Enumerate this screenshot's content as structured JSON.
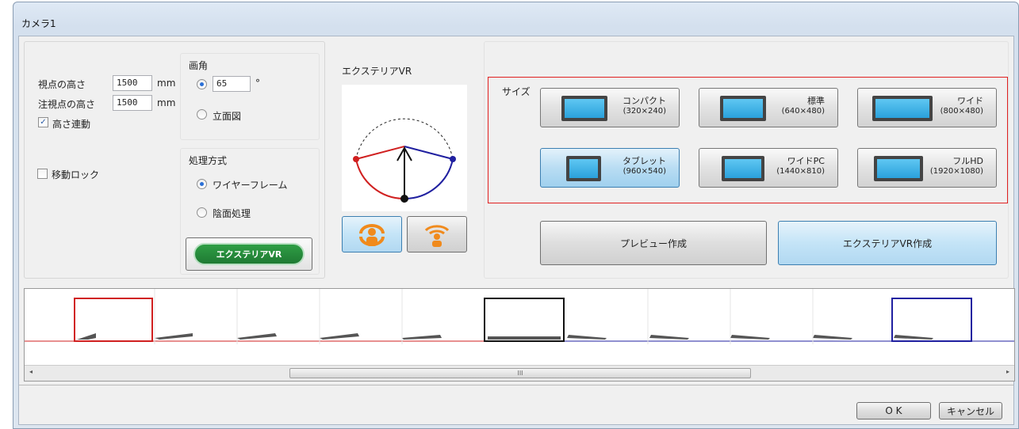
{
  "window": {
    "title": "カメラ1"
  },
  "view": {
    "eye_height_label": "視点の高さ",
    "eye_height_value": "1500",
    "eye_height_unit": "mm",
    "target_height_label": "注視点の高さ",
    "target_height_value": "1500",
    "target_height_unit": "mm",
    "link_height_label": "高さ連動",
    "link_height_checked": true,
    "angle_label": "画角",
    "angle_value": "65",
    "angle_unit": "°",
    "elevation_label": "立面図",
    "move_lock_label": "移動ロック",
    "move_lock_checked": false,
    "method_label": "処理方式",
    "wireframe_label": "ワイヤーフレーム",
    "hidden_surface_label": "陰面処理",
    "logo_text": "エクステリアVR"
  },
  "vr": {
    "section_label": "エクステリアVR",
    "size_label": "サイズ",
    "sizes": [
      {
        "name": "コンパクト",
        "res": "(320×240)",
        "selected": false
      },
      {
        "name": "標準",
        "res": "(640×480)",
        "selected": false
      },
      {
        "name": "ワイド",
        "res": "(800×480)",
        "selected": false
      },
      {
        "name": "タブレット",
        "res": "(960×540)",
        "selected": true
      },
      {
        "name": "ワイドPC",
        "res": "(1440×810)",
        "selected": false
      },
      {
        "name": "フルHD",
        "res": "(1920×1080)",
        "selected": false
      }
    ],
    "preview_button": "プレビュー作成",
    "create_button": "エクステリアVR作成"
  },
  "strip": {
    "scroll_grip": "III",
    "frame_count": 12
  },
  "footer": {
    "ok": "O K",
    "cancel": "キャンセル"
  },
  "colors": {
    "selection_border": "#e02020",
    "left_arc": "#d02020",
    "right_arc": "#2020a0",
    "accent_blue": "#3c7fb1"
  }
}
